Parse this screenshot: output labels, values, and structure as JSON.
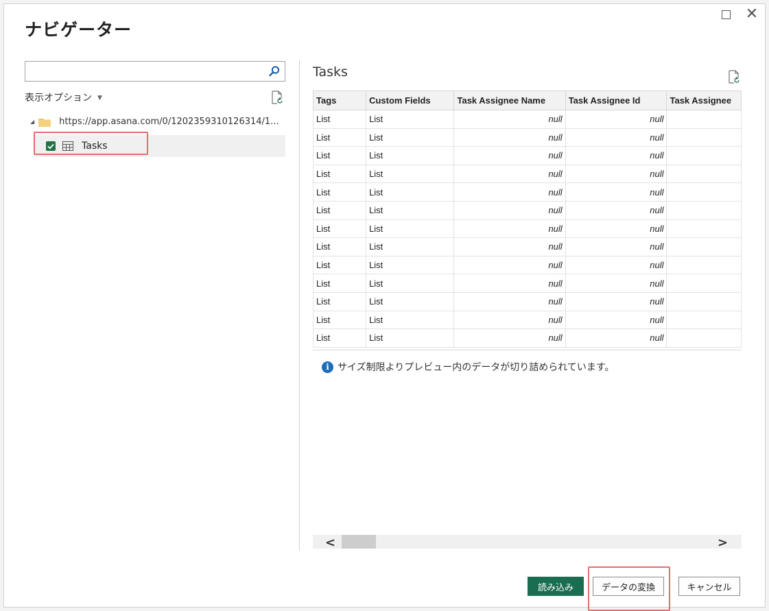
{
  "dialog": {
    "title": "ナビゲーター"
  },
  "left": {
    "search": {
      "value": "",
      "placeholder": ""
    },
    "display_options": "表示オプション",
    "tree": {
      "root_label": "https://app.asana.com/0/1202359310126314/1...",
      "items": [
        {
          "label": "Tasks",
          "checked": true
        }
      ]
    }
  },
  "preview": {
    "title": "Tasks",
    "columns": [
      "Tags",
      "Custom Fields",
      "Task Assignee Name",
      "Task Assignee Id",
      "Task Assignee"
    ],
    "rows": [
      [
        "List",
        "List",
        "null",
        "null",
        ""
      ],
      [
        "List",
        "List",
        "null",
        "null",
        ""
      ],
      [
        "List",
        "List",
        "null",
        "null",
        ""
      ],
      [
        "List",
        "List",
        "null",
        "null",
        ""
      ],
      [
        "List",
        "List",
        "null",
        "null",
        ""
      ],
      [
        "List",
        "List",
        "null",
        "null",
        ""
      ],
      [
        "List",
        "List",
        "null",
        "null",
        ""
      ],
      [
        "List",
        "List",
        "null",
        "null",
        ""
      ],
      [
        "List",
        "List",
        "null",
        "null",
        ""
      ],
      [
        "List",
        "List",
        "null",
        "null",
        ""
      ],
      [
        "List",
        "List",
        "null",
        "null",
        ""
      ],
      [
        "List",
        "List",
        "null",
        "null",
        ""
      ],
      [
        "List",
        "List",
        "null",
        "null",
        ""
      ]
    ],
    "info_message": "サイズ制限よりプレビュー内のデータが切り詰められています。"
  },
  "buttons": {
    "load": "読み込み",
    "transform": "データの変換",
    "cancel": "キャンセル"
  },
  "colors": {
    "accent": "#1b6d52",
    "checkbox": "#217346",
    "highlight": "#e46d6d",
    "info": "#1e6dba"
  },
  "icons": [
    "maximize-icon",
    "close-icon",
    "search-icon",
    "refresh-icon",
    "folder-icon",
    "table-icon",
    "info-icon",
    "scroll-left-icon",
    "scroll-right-icon"
  ]
}
